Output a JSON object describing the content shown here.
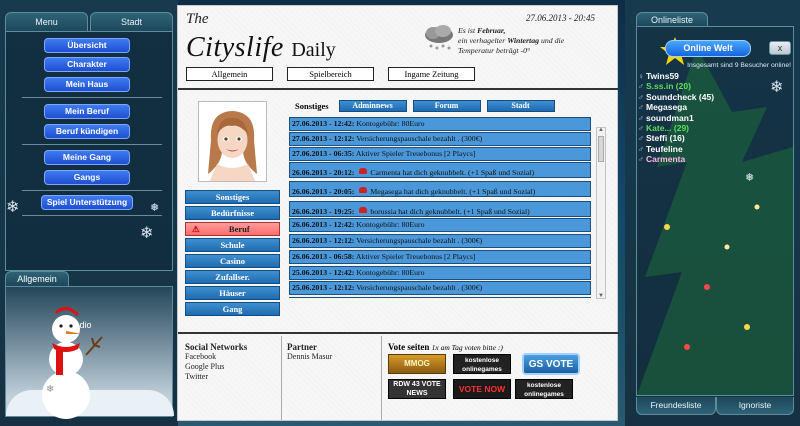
{
  "left_panel": {
    "tabs": [
      "Menu",
      "Stadt"
    ],
    "buttons": [
      "Übersicht",
      "Charakter",
      "Mein Haus",
      "Mein Beruf",
      "Beruf kündigen",
      "Meine Gang",
      "Gangs",
      "Spiel Unterstützung"
    ],
    "bottom_tab": "Allgemein",
    "radio_label": "Radio"
  },
  "header": {
    "the": "The",
    "title": "Cityslife",
    "title_suffix": "Daily",
    "datetime": "27.06.2013 - 20:45",
    "weather_line1_pre": "Es ist ",
    "weather_month": "Februar,",
    "weather_line2_pre": "ein verhagelter ",
    "weather_day": "Wintertag",
    "weather_line2_post": " und die",
    "weather_line3": "Temperatur beträgt -0°"
  },
  "nav": [
    "Allgemein",
    "Spielbereich",
    "Ingame Zeitung"
  ],
  "subnav": [
    "Sonstiges",
    "Bedürfnisse",
    "Beruf",
    "Schule",
    "Casino",
    "Zufallser.",
    "Häuser",
    "Gang"
  ],
  "news_tabs": {
    "plain": "Sonstiges",
    "buttons": [
      "Adminnews",
      "Forum",
      "Stadt"
    ]
  },
  "news": [
    {
      "time": "27.06.2013 - 12:42:",
      "text": "Kontogebühr: 80Euro",
      "rose": false
    },
    {
      "time": "27.06.2013 - 12:12:",
      "text": "Versicherungspauschale bezahlt . (300€)",
      "rose": false
    },
    {
      "time": "27.06.2013 - 06:35:",
      "text": "Aktiver Spieler Treuebonus [2 Playcs]",
      "rose": false
    },
    {
      "time": "26.06.2013 - 20:12:",
      "text": "Carmenta hat dich geknubbelt. (+1 Spaß und Sozial)",
      "rose": true
    },
    {
      "time": "26.06.2013 - 20:05:",
      "text": "Megasega hat dich geknubbelt. (+1 Spaß und Sozial)",
      "rose": true
    },
    {
      "time": "26.06.2013 - 19:25:",
      "text": "borussia hat dich geknubbelt. (+1 Spaß und Sozial)",
      "rose": true
    },
    {
      "time": "26.06.2013 - 12:42:",
      "text": "Kontogebühr: 80Euro",
      "rose": false
    },
    {
      "time": "26.06.2013 - 12:12:",
      "text": "Versicherungspauschale bezahlt . (300€)",
      "rose": false
    },
    {
      "time": "26.06.2013 - 06:58:",
      "text": "Aktiver Spieler Treuebonus [2 Playcs]",
      "rose": false
    },
    {
      "time": "25.06.2013 - 12:42:",
      "text": "Kontogebühr: 80Euro",
      "rose": false
    },
    {
      "time": "25.06.2013 - 12:12:",
      "text": "Versicherungspauschale bezahlt . (300€)",
      "rose": false
    },
    {
      "time": "25.06.2013 - 06:39:",
      "text": "Aktiver Spieler Treuebonus [2 Playcs]",
      "rose": false
    }
  ],
  "footer": {
    "social_title": "Social Networks",
    "social_links": [
      "Facebook",
      "Google Plus",
      "Twitter"
    ],
    "partner_title": "Partner",
    "partner_links": [
      "Dennis Masur"
    ],
    "vote_title": "Vote seiten",
    "vote_hint": "1x am Tag voten bitte :)",
    "vote_buttons": [
      "MMOG CHARTS",
      "kostenlose onlinegames",
      "GS VOTE",
      "RDW 43 VOTE NEWS",
      "VOTE NOW",
      "kostenlose onlinegames"
    ]
  },
  "right_panel": {
    "tab": "Onlineliste",
    "online_button": "Online Welt",
    "online_info": "Insgesamt sind 9 Besucher online!",
    "close_label": "x",
    "users": [
      {
        "name": "Twins59",
        "suffix": "",
        "style": "white"
      },
      {
        "name": "S.ss.in",
        "suffix": "(20)",
        "style": "green"
      },
      {
        "name": "Soundcheck",
        "suffix": "(45)",
        "style": "white"
      },
      {
        "name": "Megasega",
        "suffix": "",
        "style": "white"
      },
      {
        "name": "soundman1",
        "suffix": "",
        "style": "white"
      },
      {
        "name": "Kate...",
        "suffix": "(29)",
        "style": "green"
      },
      {
        "name": "Steffi",
        "suffix": "(16)",
        "style": "white"
      },
      {
        "name": "Teufeline",
        "suffix": "",
        "style": "white"
      },
      {
        "name": "Carmenta",
        "suffix": "",
        "style": "pink"
      }
    ],
    "bottom_tabs": [
      "Freundesliste",
      "Ignoriste"
    ]
  }
}
